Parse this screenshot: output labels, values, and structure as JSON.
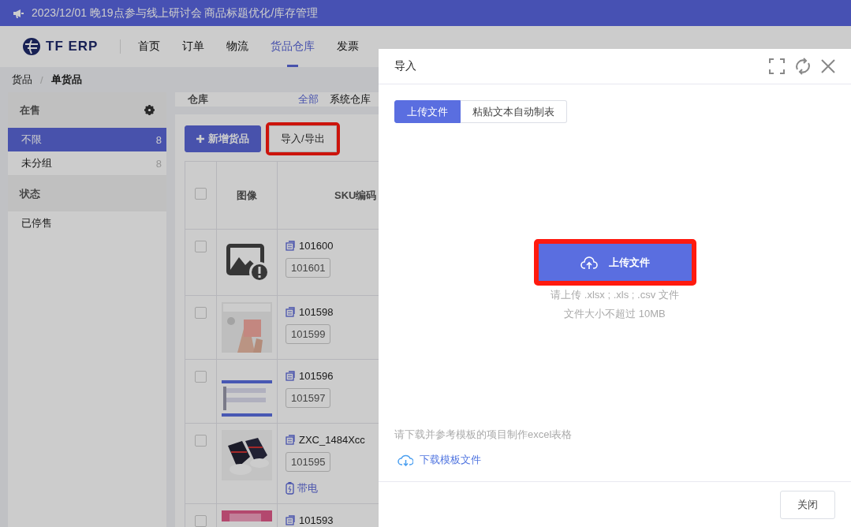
{
  "banner": {
    "text": "2023/12/01 晚19点参与线上研讨会 商品标题优化/库存管理"
  },
  "nav": {
    "logo": "TF ERP",
    "items": [
      {
        "label": "首页",
        "selected": false
      },
      {
        "label": "订单",
        "selected": false
      },
      {
        "label": "物流",
        "selected": false
      },
      {
        "label": "货品仓库",
        "selected": true
      },
      {
        "label": "发票",
        "selected": false
      }
    ]
  },
  "breadcrumb": {
    "separator": "/",
    "items": [
      "货品",
      "单货品"
    ]
  },
  "sidebar": {
    "groups": [
      {
        "title": "在售",
        "settings": true,
        "items": [
          {
            "label": "不限",
            "count": "8",
            "selected": true
          },
          {
            "label": "未分组",
            "count": "8",
            "selected": false
          }
        ]
      },
      {
        "title": "状态",
        "settings": false,
        "items": [
          {
            "label": "已停售",
            "selected": false
          }
        ]
      }
    ]
  },
  "warehouse": {
    "label": "仓库",
    "options": [
      {
        "label": "全部",
        "selected": true
      },
      {
        "label": "系统仓库",
        "selected": false
      }
    ]
  },
  "toolbar": [
    {
      "kind": "primary",
      "label": "新增货品",
      "highlighted": false
    },
    {
      "kind": "default",
      "label": "导入/导出",
      "highlighted": true
    }
  ],
  "table": {
    "select_all": {
      "checked": false
    },
    "columns": [
      "图像",
      "SKU编码"
    ],
    "rows": [
      {
        "checked": false,
        "image": {
          "kind": "placeholder"
        },
        "sku": "101600",
        "code": "101601"
      },
      {
        "checked": false,
        "sku": "101598",
        "code": "101599"
      },
      {
        "checked": false,
        "sku": "101596",
        "code": "101597"
      },
      {
        "checked": false,
        "sku": "ZXC_1484Xcc",
        "code": "101595",
        "tag": "带电"
      },
      {
        "checked": false,
        "sku": "101593"
      }
    ]
  },
  "drawer": {
    "title": "导入",
    "tabs": [
      {
        "label": "上传文件",
        "selected": true
      },
      {
        "label": "粘贴文本自动制表",
        "selected": false
      }
    ],
    "upload_button": {
      "label": "上传文件",
      "highlighted": true
    },
    "hints": [
      "请上传 .xlsx ; .xls ; .csv 文件",
      "文件大小不超过 10MB"
    ],
    "template_note": "请下载并参考模板的项目制作excel表格",
    "template_link": "下载模板文件",
    "close_button": "关闭"
  }
}
